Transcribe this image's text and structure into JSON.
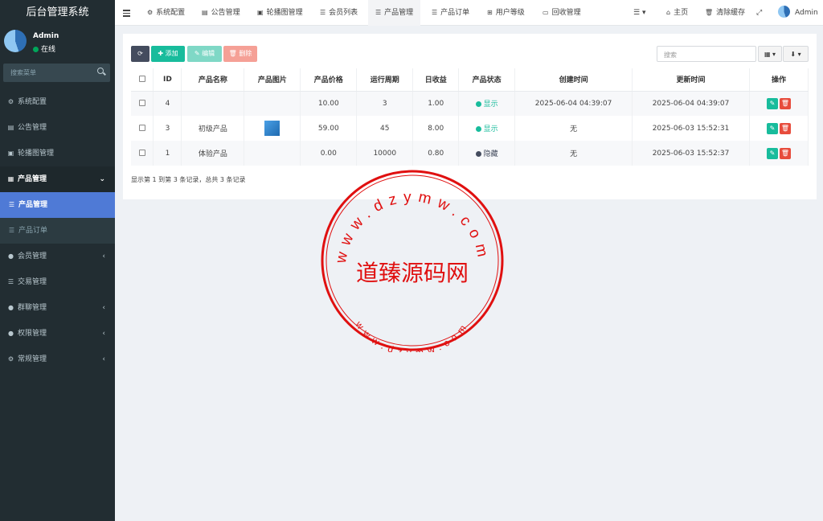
{
  "sidebar": {
    "brand": "后台管理系统",
    "user": {
      "name": "Admin",
      "status": "在线"
    },
    "search_placeholder": "搜索菜单",
    "items": [
      {
        "label": "系统配置",
        "icon": "gear-icon"
      },
      {
        "label": "公告管理",
        "icon": "file-icon"
      },
      {
        "label": "轮播图管理",
        "icon": "image-icon"
      },
      {
        "label": "产品管理",
        "icon": "table-icon",
        "open": true
      },
      {
        "label": "产品管理",
        "icon": "list-icon",
        "active": true
      },
      {
        "label": "产品订单",
        "icon": "list-icon"
      },
      {
        "label": "会员管理",
        "icon": "user-icon"
      },
      {
        "label": "交易管理",
        "icon": "list-icon"
      },
      {
        "label": "群聊管理",
        "icon": "chat-icon"
      },
      {
        "label": "权限管理",
        "icon": "group-icon"
      },
      {
        "label": "常规管理",
        "icon": "cogs-icon"
      }
    ]
  },
  "topnav": {
    "tabs": [
      {
        "label": "系统配置",
        "icon": "gear-icon"
      },
      {
        "label": "公告管理",
        "icon": "file-icon"
      },
      {
        "label": "轮播图管理",
        "icon": "image-icon"
      },
      {
        "label": "会员列表",
        "icon": "list-icon"
      },
      {
        "label": "产品管理",
        "icon": "list-icon",
        "active": true
      },
      {
        "label": "产品订单",
        "icon": "list-icon"
      },
      {
        "label": "用户等级",
        "icon": "sitemap-icon"
      },
      {
        "label": "回收管理",
        "icon": "card-icon"
      }
    ],
    "home": "主页",
    "clear_cache": "清除缓存",
    "user": "Admin"
  },
  "toolbar": {
    "add": "添加",
    "edit": "编辑",
    "delete": "删除",
    "search_placeholder": "搜索"
  },
  "table": {
    "headers": [
      "ID",
      "产品名称",
      "产品图片",
      "产品价格",
      "运行周期",
      "日收益",
      "产品状态",
      "创建时间",
      "更新时间",
      "操作"
    ],
    "rows": [
      {
        "id": "4",
        "name": "",
        "image": false,
        "price": "10.00",
        "cycle": "3",
        "daily": "1.00",
        "status": "显示",
        "status_on": true,
        "created": "2025-06-04 04:39:07",
        "updated": "2025-06-04 04:39:07"
      },
      {
        "id": "3",
        "name": "初级产品",
        "image": true,
        "price": "59.00",
        "cycle": "45",
        "daily": "8.00",
        "status": "显示",
        "status_on": true,
        "created": "无",
        "updated": "2025-06-03 15:52:31"
      },
      {
        "id": "1",
        "name": "体验产品",
        "image": false,
        "price": "0.00",
        "cycle": "10000",
        "daily": "0.80",
        "status": "隐藏",
        "status_on": false,
        "created": "无",
        "updated": "2025-06-03 15:52:37"
      }
    ],
    "footer": "显示第 1 到第 3 条记录，总共 3 条记录"
  },
  "watermark": {
    "center": "道臻源码网",
    "top_ring": "www.dzymw.com",
    "bottom_ring": "www.dzymw.com"
  },
  "colors": {
    "sidebar_bg": "#222d32",
    "accent_active": "#4f7ad6",
    "success": "#18bc9c",
    "danger": "#e74c3c",
    "stamp_red": "#e01010"
  }
}
